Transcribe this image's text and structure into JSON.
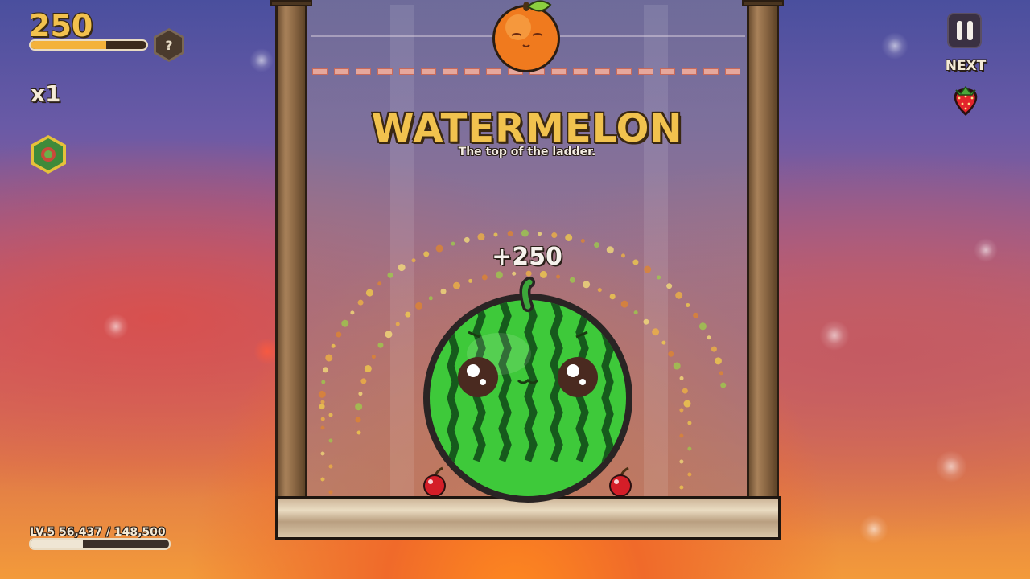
{
  "hud": {
    "score": "250",
    "score_progress": 0.65,
    "hint_label": "?",
    "multiplier": "x1",
    "level_text": "LV.5 56,437 / 148,500",
    "level_progress": 0.38,
    "next_label": "NEXT",
    "next_fruit": "strawberry-icon"
  },
  "banner": {
    "title": "WATERMELON",
    "subtitle": "The top of the ladder."
  },
  "score_popup": "+250",
  "playfield": {
    "dropping_fruit": "orange",
    "merged_fruit": "watermelon",
    "resting_fruits": [
      "cherry",
      "cherry"
    ]
  },
  "colors": {
    "accent_gold": "#f1c24e",
    "watermelon_green": "#3cc43a",
    "danger_line": "#e6a79c"
  }
}
